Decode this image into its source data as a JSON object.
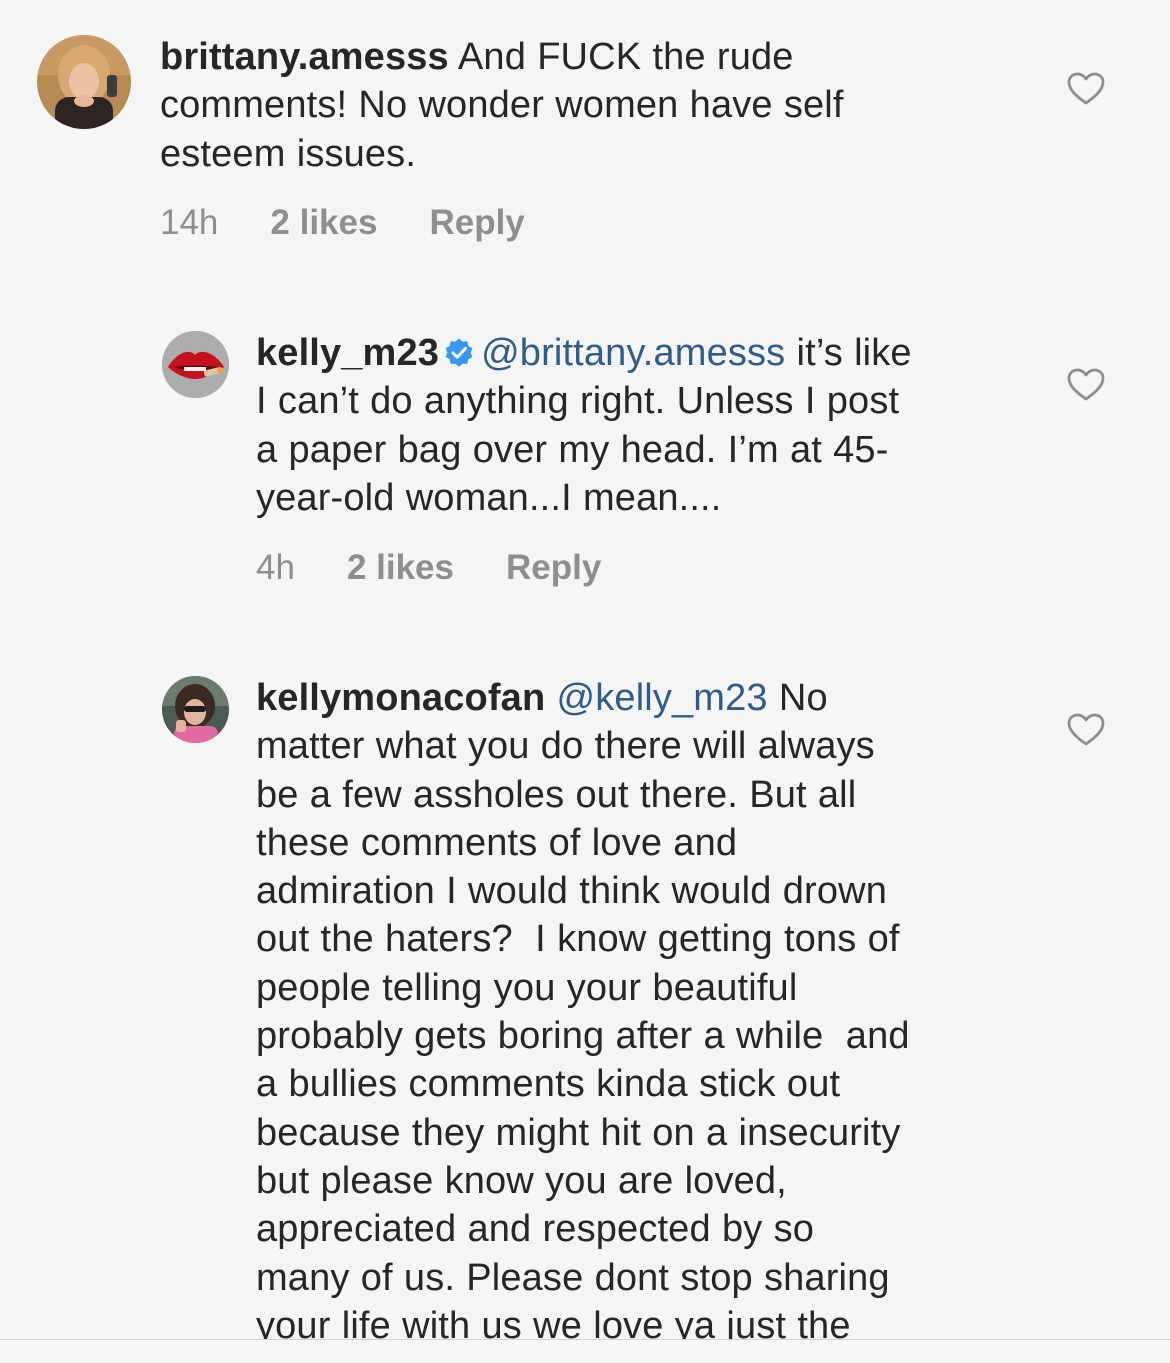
{
  "comments": [
    {
      "username": "brittany.amesss",
      "mention": "",
      "lines": [
        "And FUCK the rude",
        "comments! No wonder women have self",
        "esteem issues."
      ],
      "time": "14h",
      "likes": "2 likes",
      "reply": "Reply"
    },
    {
      "username": "kelly_m23",
      "verified": true,
      "mention": "@brittany.amesss",
      "lines": [
        "it’s like",
        "I can’t do anything right. Unless I post",
        "a paper bag over my head. I’m at 45-",
        "year-old woman...I mean...."
      ],
      "time": "4h",
      "likes": "2 likes",
      "reply": "Reply"
    },
    {
      "username": "kellymonacofan",
      "mention": "@kelly_m23",
      "lines": [
        "No",
        "matter what you do there will always",
        "be a few assholes out there. But all",
        "these comments of love and",
        "admiration I would think would drown",
        "out the haters?  I know getting tons of",
        "people telling you your beautiful",
        "probably gets boring after a while  and",
        "a bullies comments kinda stick out",
        "because they might hit on a insecurity",
        "but please know you are loved,",
        "appreciated and respected by so",
        "many of us. Please dont stop sharing",
        "your life with us we love ya just the"
      ]
    }
  ],
  "colors": {
    "background": "#f5f5f5",
    "text": "#262626",
    "mention": "#2f5c8a",
    "meta": "#8e8e8e",
    "verified": "#3897f0"
  },
  "icons": {
    "like": "heart-outline-icon",
    "verified": "verified-badge-icon"
  }
}
